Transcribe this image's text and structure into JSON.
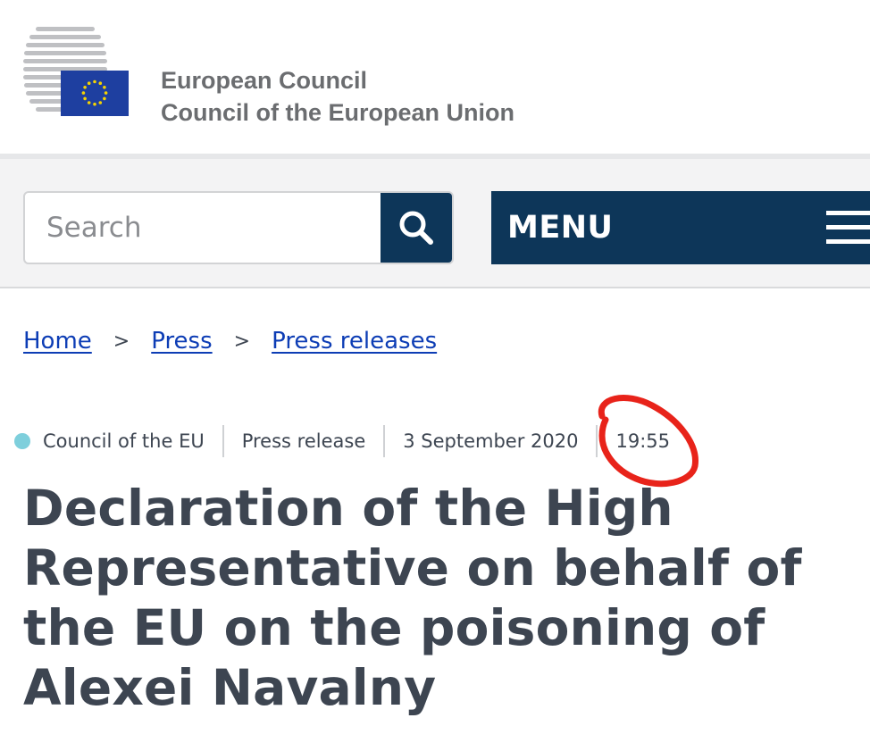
{
  "header": {
    "org_line_1": "European Council",
    "org_line_2": "Council of the European Union",
    "flag_color": "#1e3fa0",
    "star_color": "#f5d300"
  },
  "nav": {
    "search_placeholder": "Search",
    "menu_label": "MENU",
    "accent_color": "#0d3659"
  },
  "breadcrumb": {
    "items": [
      {
        "label": "Home"
      },
      {
        "label": "Press"
      },
      {
        "label": "Press releases"
      }
    ],
    "separator": ">"
  },
  "meta": {
    "council": "Council of the EU",
    "type": "Press release",
    "date": "3 September 2020",
    "time": "19:55",
    "dot_color": "#7ecfdc"
  },
  "article": {
    "title": "Declaration of the High Representative on behalf of the EU on the poisoning of Alexei Navalny"
  },
  "annotation": {
    "color": "#e8231a",
    "shape": "circled-time"
  }
}
